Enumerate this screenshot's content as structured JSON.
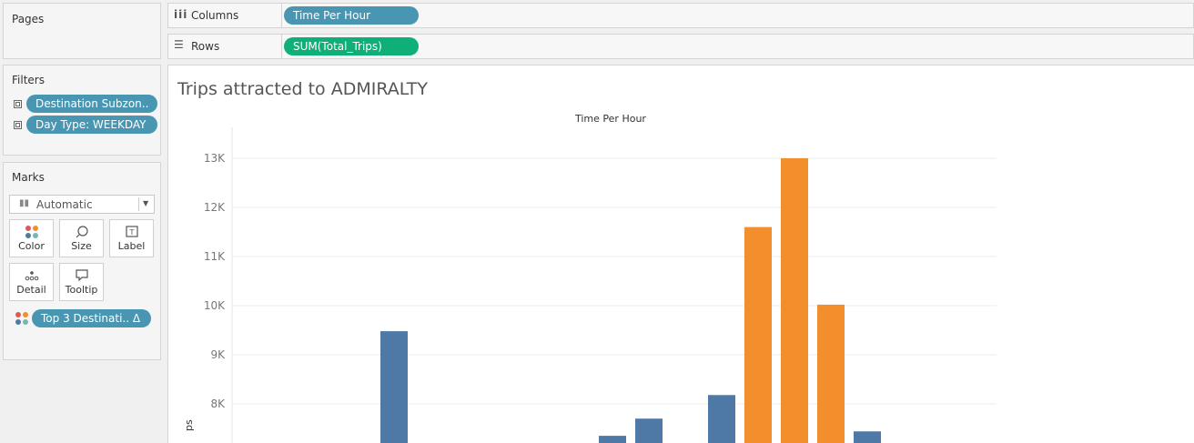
{
  "pages": {
    "title": "Pages"
  },
  "shelves": {
    "columns": {
      "label": "Columns",
      "pill": "Time Per  Hour"
    },
    "rows": {
      "label": "Rows",
      "pill": "SUM(Total_Trips)"
    }
  },
  "filters": {
    "title": "Filters",
    "items": [
      {
        "label": "Destination  Subzon.."
      },
      {
        "label": "Day  Type: WEEKDAY"
      }
    ]
  },
  "marks": {
    "title": "Marks",
    "type_selected": "Automatic",
    "buttons": [
      {
        "label": "Color",
        "icon": "color-icon"
      },
      {
        "label": "Size",
        "icon": "size-icon"
      },
      {
        "label": "Label",
        "icon": "label-icon"
      },
      {
        "label": "Detail",
        "icon": "detail-icon"
      },
      {
        "label": "Tooltip",
        "icon": "tooltip-icon"
      }
    ],
    "color_pill": "Top 3 Destinati..  Δ"
  },
  "view": {
    "title": "Trips attracted to ADMIRALTY",
    "column_header": "Time Per  Hour",
    "y_axis_fragment": "ps"
  },
  "colors": {
    "pill_blue": "#4996b2",
    "pill_green": "#0faf78",
    "bar_default": "#4e79a7",
    "bar_top3": "#f28e2b"
  },
  "chart_data": {
    "type": "bar",
    "title": "Trips attracted to ADMIRALTY",
    "xlabel": "Time Per  Hour",
    "ylabel": "",
    "y_ticks": [
      "8K",
      "9K",
      "10K",
      "11K",
      "12K",
      "13K"
    ],
    "y_tick_values": [
      8000,
      9000,
      10000,
      11000,
      12000,
      13000
    ],
    "ylim_visible": [
      7200,
      13500
    ],
    "bars": [
      {
        "value": 9480,
        "highlight": false
      },
      {
        "value": 7350,
        "highlight": false
      },
      {
        "value": 7700,
        "highlight": false
      },
      {
        "value": 8180,
        "highlight": false
      },
      {
        "value": 11600,
        "highlight": true
      },
      {
        "value": 13000,
        "highlight": true
      },
      {
        "value": 10020,
        "highlight": true
      },
      {
        "value": 7440,
        "highlight": false
      }
    ]
  }
}
